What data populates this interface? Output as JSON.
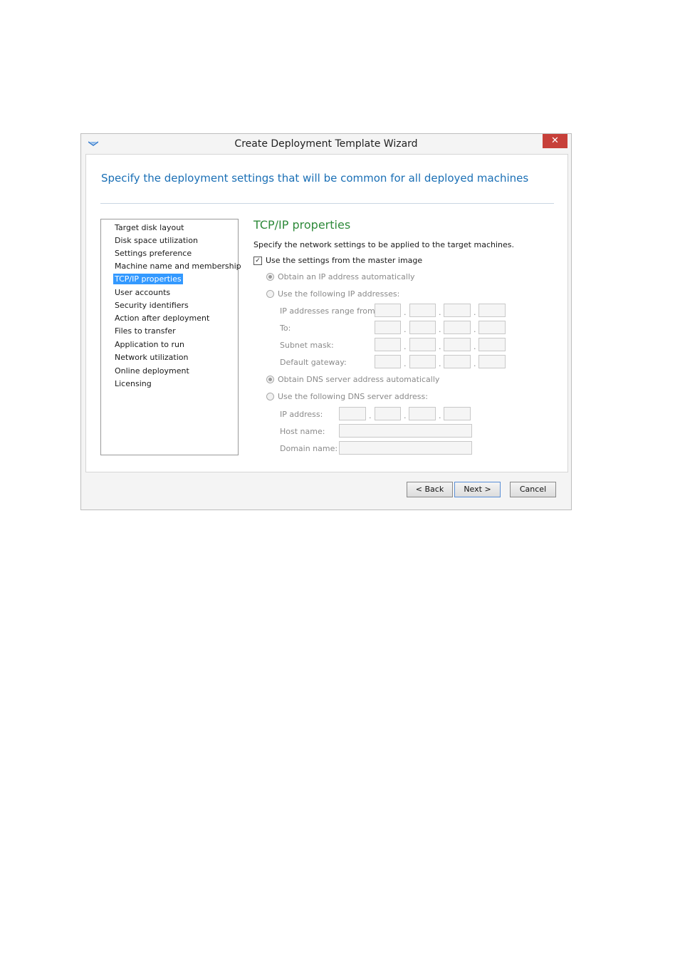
{
  "window": {
    "title": "Create Deployment Template Wizard",
    "close_label": "✕"
  },
  "header": {
    "headline": "Specify the deployment settings that will be common for all deployed machines"
  },
  "nav": {
    "items": [
      {
        "label": "Target disk layout",
        "selected": false
      },
      {
        "label": "Disk space utilization",
        "selected": false
      },
      {
        "label": "Settings preference",
        "selected": false
      },
      {
        "label": "Machine name and membership",
        "selected": false
      },
      {
        "label": "TCP/IP properties",
        "selected": true
      },
      {
        "label": "User accounts",
        "selected": false
      },
      {
        "label": "Security identifiers",
        "selected": false
      },
      {
        "label": "Action after deployment",
        "selected": false
      },
      {
        "label": "Files to transfer",
        "selected": false
      },
      {
        "label": "Application to run",
        "selected": false
      },
      {
        "label": "Network utilization",
        "selected": false
      },
      {
        "label": "Online deployment",
        "selected": false
      },
      {
        "label": "Licensing",
        "selected": false
      }
    ]
  },
  "page": {
    "title": "TCP/IP properties",
    "description": "Specify the network settings to be applied to the target machines.",
    "use_master": {
      "label": "Use the settings from the master image",
      "checked": true,
      "check_glyph": "✓"
    },
    "ip_auto": {
      "label": "Obtain an IP address automatically",
      "selected": true
    },
    "ip_manual": {
      "label": "Use the following IP addresses:",
      "selected": false
    },
    "ip_range_from_label": "IP addresses range from:",
    "to_label": "To:",
    "subnet_label": "Subnet mask:",
    "gateway_label": "Default gateway:",
    "dns_auto": {
      "label": "Obtain DNS server address automatically",
      "selected": true
    },
    "dns_manual": {
      "label": "Use the following DNS server address:",
      "selected": false
    },
    "dns_ip_label": "IP address:",
    "host_label": "Host name:",
    "domain_label": "Domain name:",
    "ip_separator": "."
  },
  "footer": {
    "back": "< Back",
    "next": "Next >",
    "cancel": "Cancel"
  }
}
